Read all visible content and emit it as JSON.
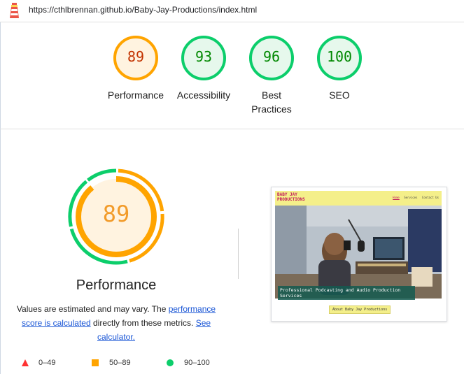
{
  "url": "https://cthlbrennan.github.io/Baby-Jay-Productions/index.html",
  "colors": {
    "average": "#f29b2a",
    "pass": "#0cce6b",
    "fail": "#ff3333",
    "link": "#1a56d6"
  },
  "scores": [
    {
      "label": "Performance",
      "score": 89,
      "rating": "average",
      "color": "#c33300",
      "ring": "#ffa400",
      "fill": "#fff3e0"
    },
    {
      "label": "Accessibility",
      "score": 93,
      "rating": "pass",
      "color": "#008800",
      "ring": "#0cce6b",
      "fill": "#e6f8ec"
    },
    {
      "label": "Best Practices",
      "score": 96,
      "rating": "pass",
      "color": "#008800",
      "ring": "#0cce6b",
      "fill": "#e6f8ec"
    },
    {
      "label": "SEO",
      "score": 100,
      "rating": "pass",
      "color": "#008800",
      "ring": "#0cce6b",
      "fill": "#e6f8ec"
    }
  ],
  "performance": {
    "score": 89,
    "title": "Performance",
    "desc_1": "Values are estimated and may vary. The ",
    "link_1": "performance score is calculated",
    "desc_2": " directly from these metrics. ",
    "link_2": "See calculator."
  },
  "screenshot": {
    "brand_line1": "BABY JAY",
    "brand_line2": "PRODUCTIONS",
    "nav": [
      "Home",
      "Services",
      "Contact Us"
    ],
    "caption": "Professional Podcasting and Audio Production Services",
    "button": "About Baby Jay Productions"
  },
  "legend": [
    {
      "range": "0–49",
      "icon": "triangle-icon",
      "color": "#ff3333"
    },
    {
      "range": "50–89",
      "icon": "square-icon",
      "color": "#ffa400"
    },
    {
      "range": "90–100",
      "icon": "circle-icon",
      "color": "#0cce6b"
    }
  ]
}
